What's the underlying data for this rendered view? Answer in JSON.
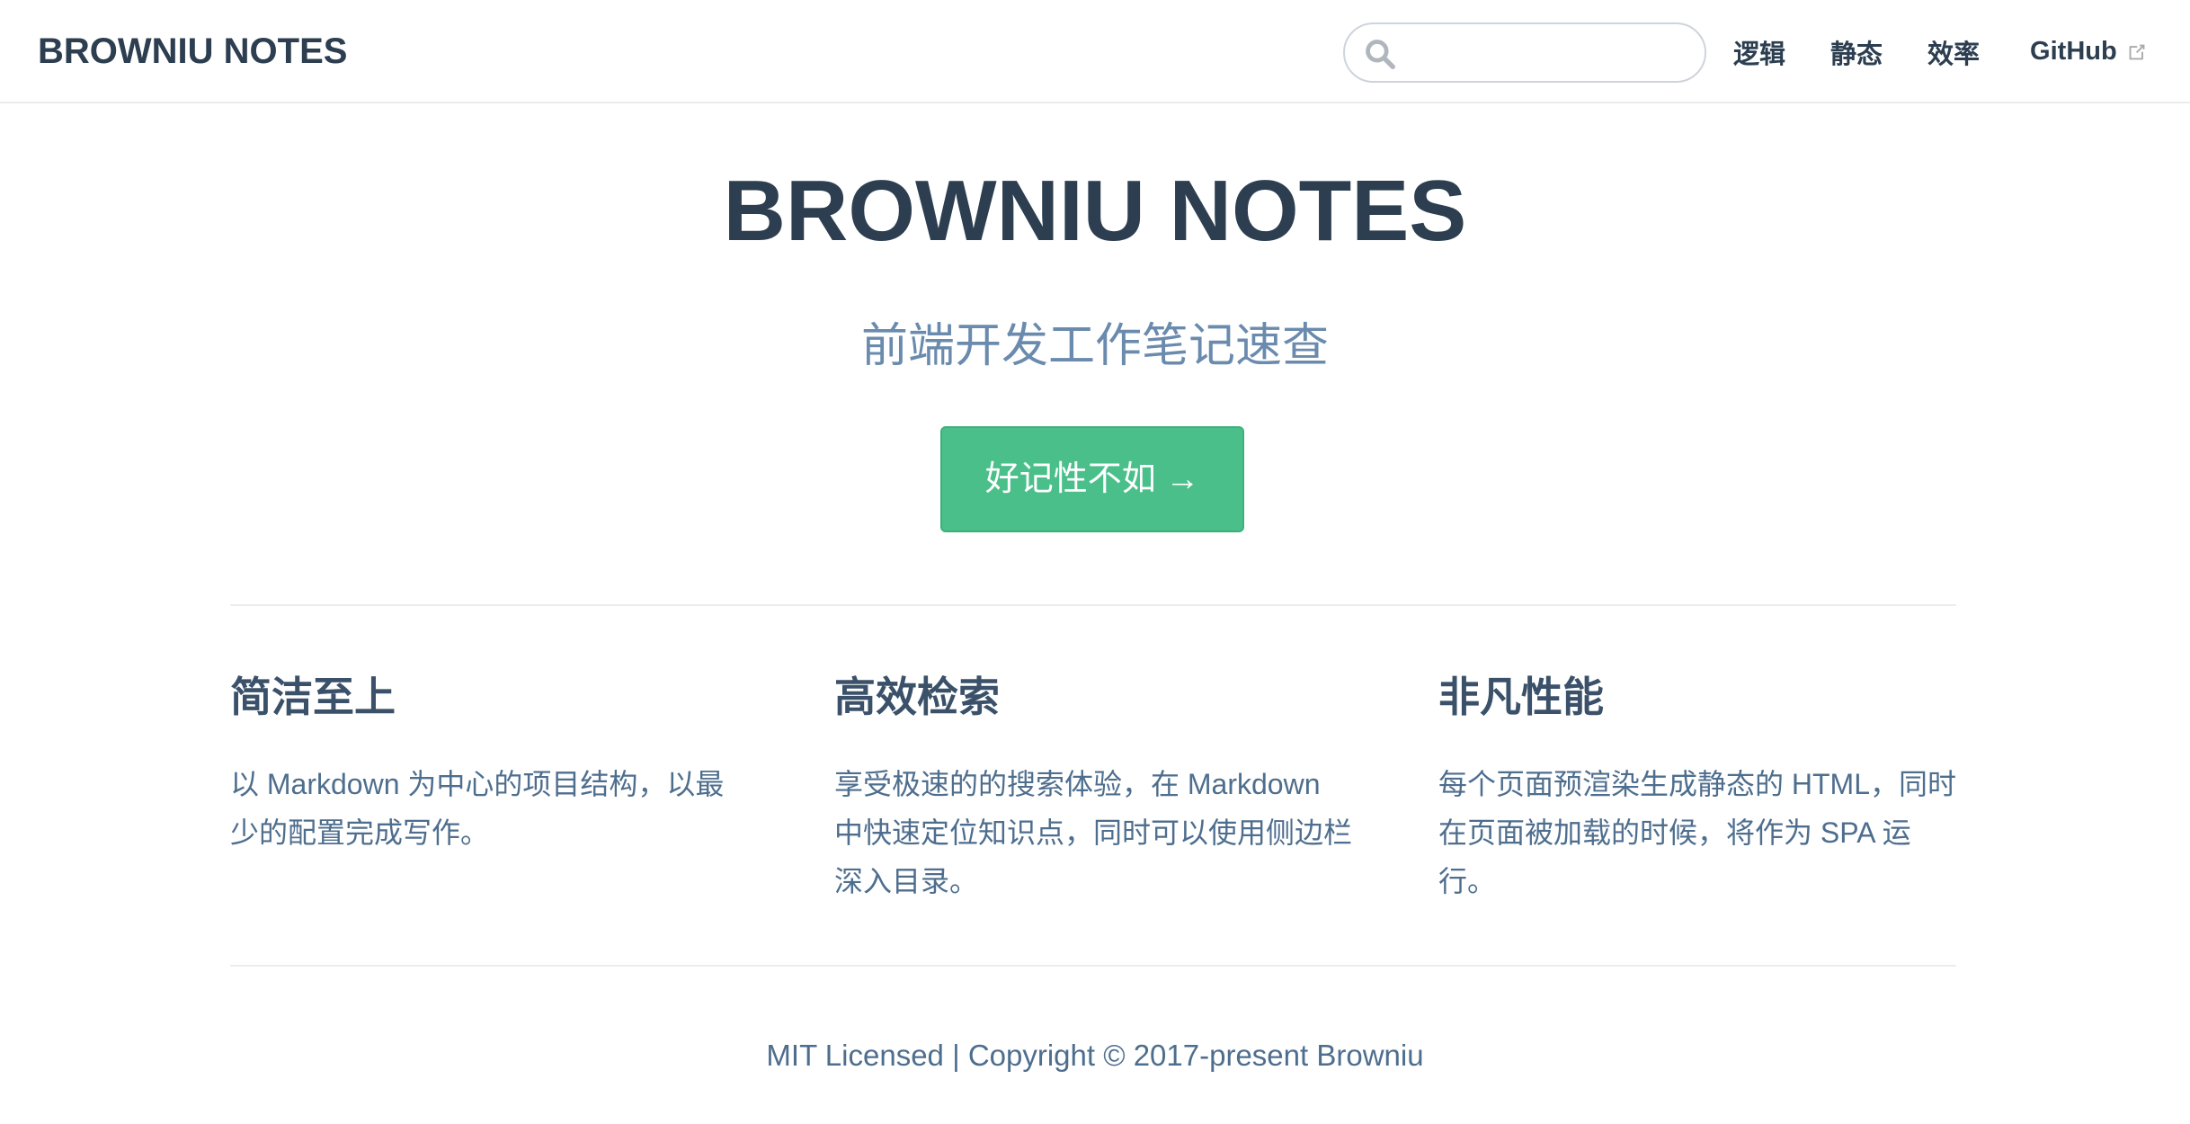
{
  "navbar": {
    "site_name": "BROWNIU NOTES",
    "search": {
      "value": "",
      "placeholder": ""
    },
    "links": [
      "逻辑",
      "静态",
      "效率"
    ],
    "github_label": "GitHub"
  },
  "hero": {
    "title": "BROWNIU NOTES",
    "description": "前端开发工作笔记速查",
    "action_label": "好记性不如 →"
  },
  "features": [
    {
      "title": "简洁至上",
      "details": "以 Markdown 为中心的项目结构，以最少的配置完成写作。"
    },
    {
      "title": "高效检索",
      "details": "享受极速的的搜索体验，在 Markdown 中快速定位知识点，同时可以使用侧边栏深入目录。"
    },
    {
      "title": "非凡性能",
      "details": "每个页面预渲染生成静态的 HTML，同时在页面被加载的时候，将作为 SPA 运行。"
    }
  ],
  "footer": "MIT Licensed | Copyright © 2017-present Browniu",
  "colors": {
    "text": "#2c3e50",
    "accent": "#3eaf7c",
    "button_bg": "#4abf8a",
    "muted": "#6a8bad"
  },
  "icons": [
    "search-icon",
    "external-link-icon"
  ]
}
